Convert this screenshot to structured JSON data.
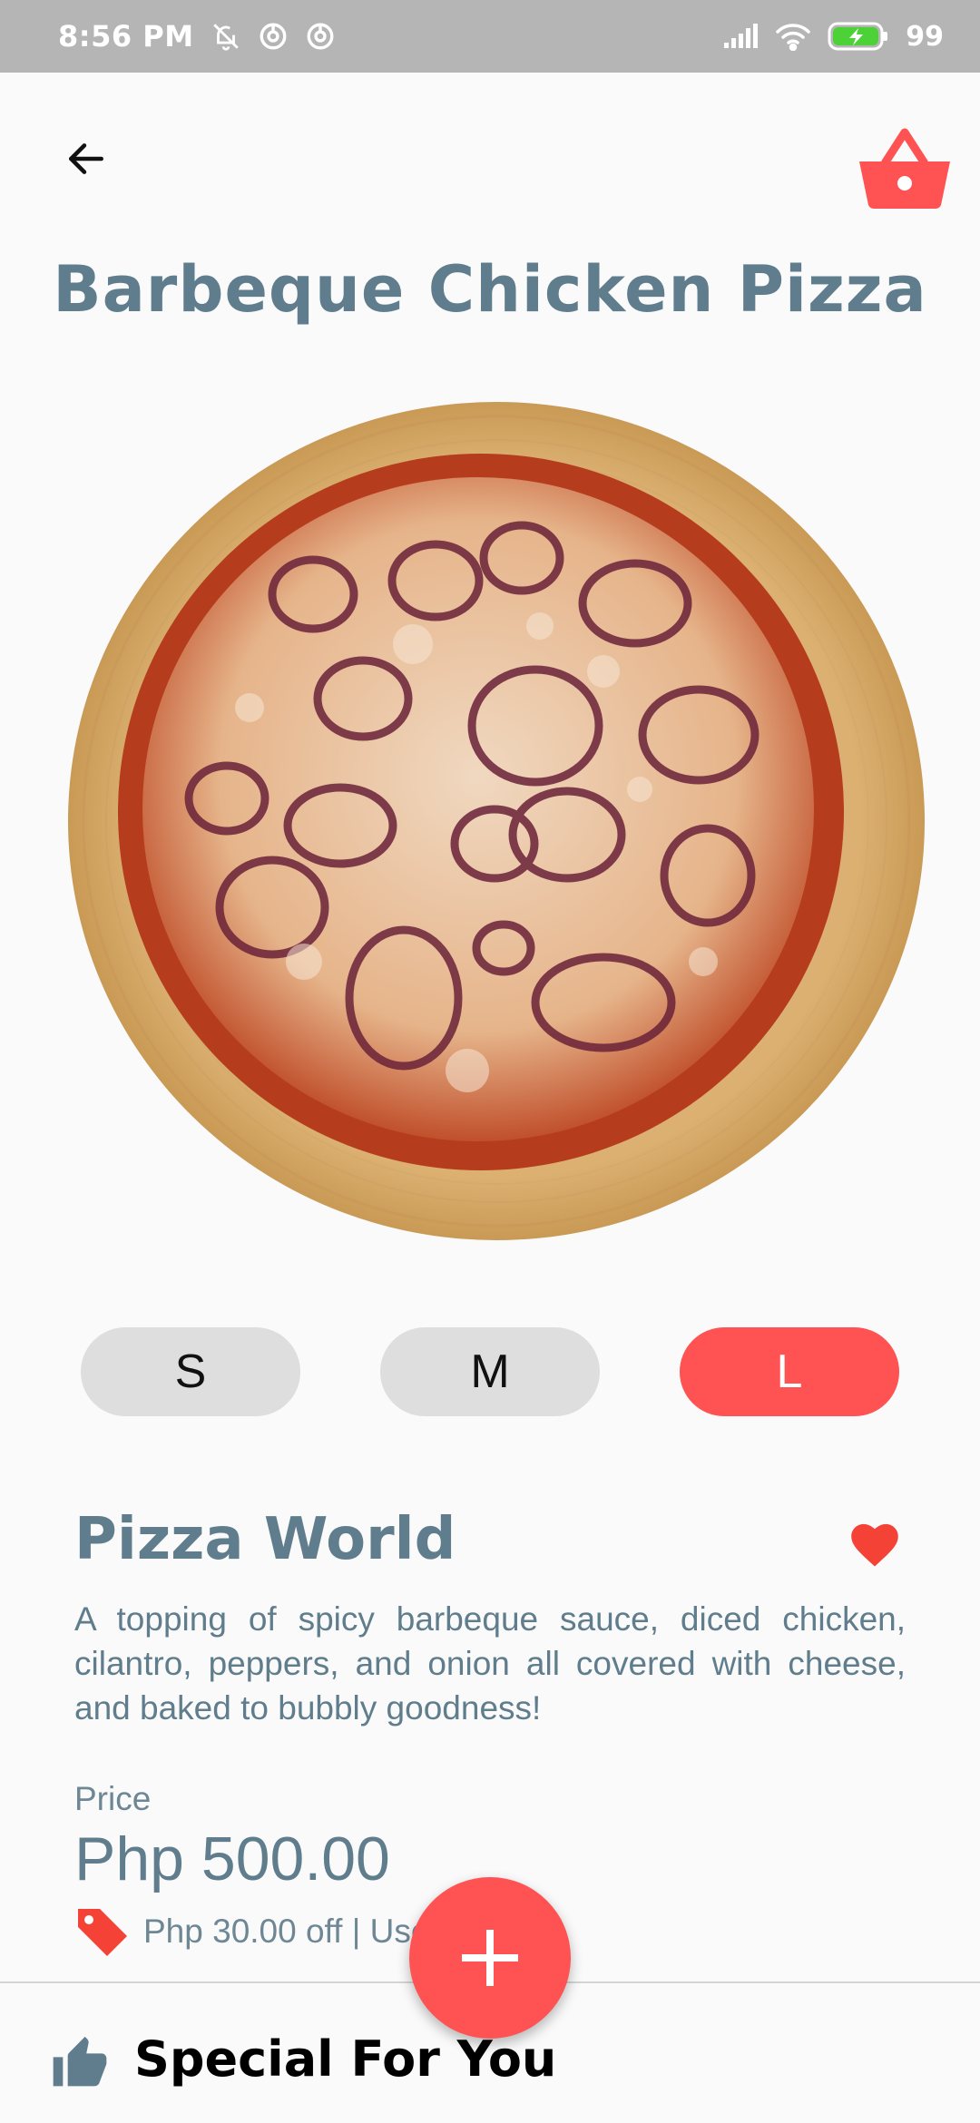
{
  "status_bar": {
    "time": "8:56 PM",
    "battery": "99",
    "icons": [
      "mute-icon",
      "sync-icon",
      "sync-icon",
      "signal-icon",
      "wifi-icon",
      "battery-charging-icon"
    ]
  },
  "header": {
    "back_icon": "arrow-left-icon",
    "cart_icon": "basket-icon"
  },
  "product": {
    "title": "Barbeque Chicken Pizza",
    "image_description_icon": "pizza-image"
  },
  "sizes": {
    "options": [
      "S",
      "M",
      "L"
    ],
    "selected": "L"
  },
  "restaurant": {
    "name": "Pizza World",
    "favorite_icon": "heart-icon",
    "description": "A topping of spicy barbeque sauce, diced chicken, cilantro, peppers, and onion all covered with cheese, and baked to bubbly goodness!"
  },
  "pricing": {
    "label": "Price",
    "value": "Php 500.00",
    "promo_icon": "tag-icon",
    "promo_text": "Php 30.00 off | Use FoodGT"
  },
  "fab": {
    "icon": "plus-icon"
  },
  "section": {
    "icon": "thumbs-up-icon",
    "title": "Special For You"
  },
  "colors": {
    "accent": "#ff5252",
    "title_text": "#5f7d8c",
    "chip_inactive": "#dedede",
    "status_bar": "#b5b5b5"
  }
}
